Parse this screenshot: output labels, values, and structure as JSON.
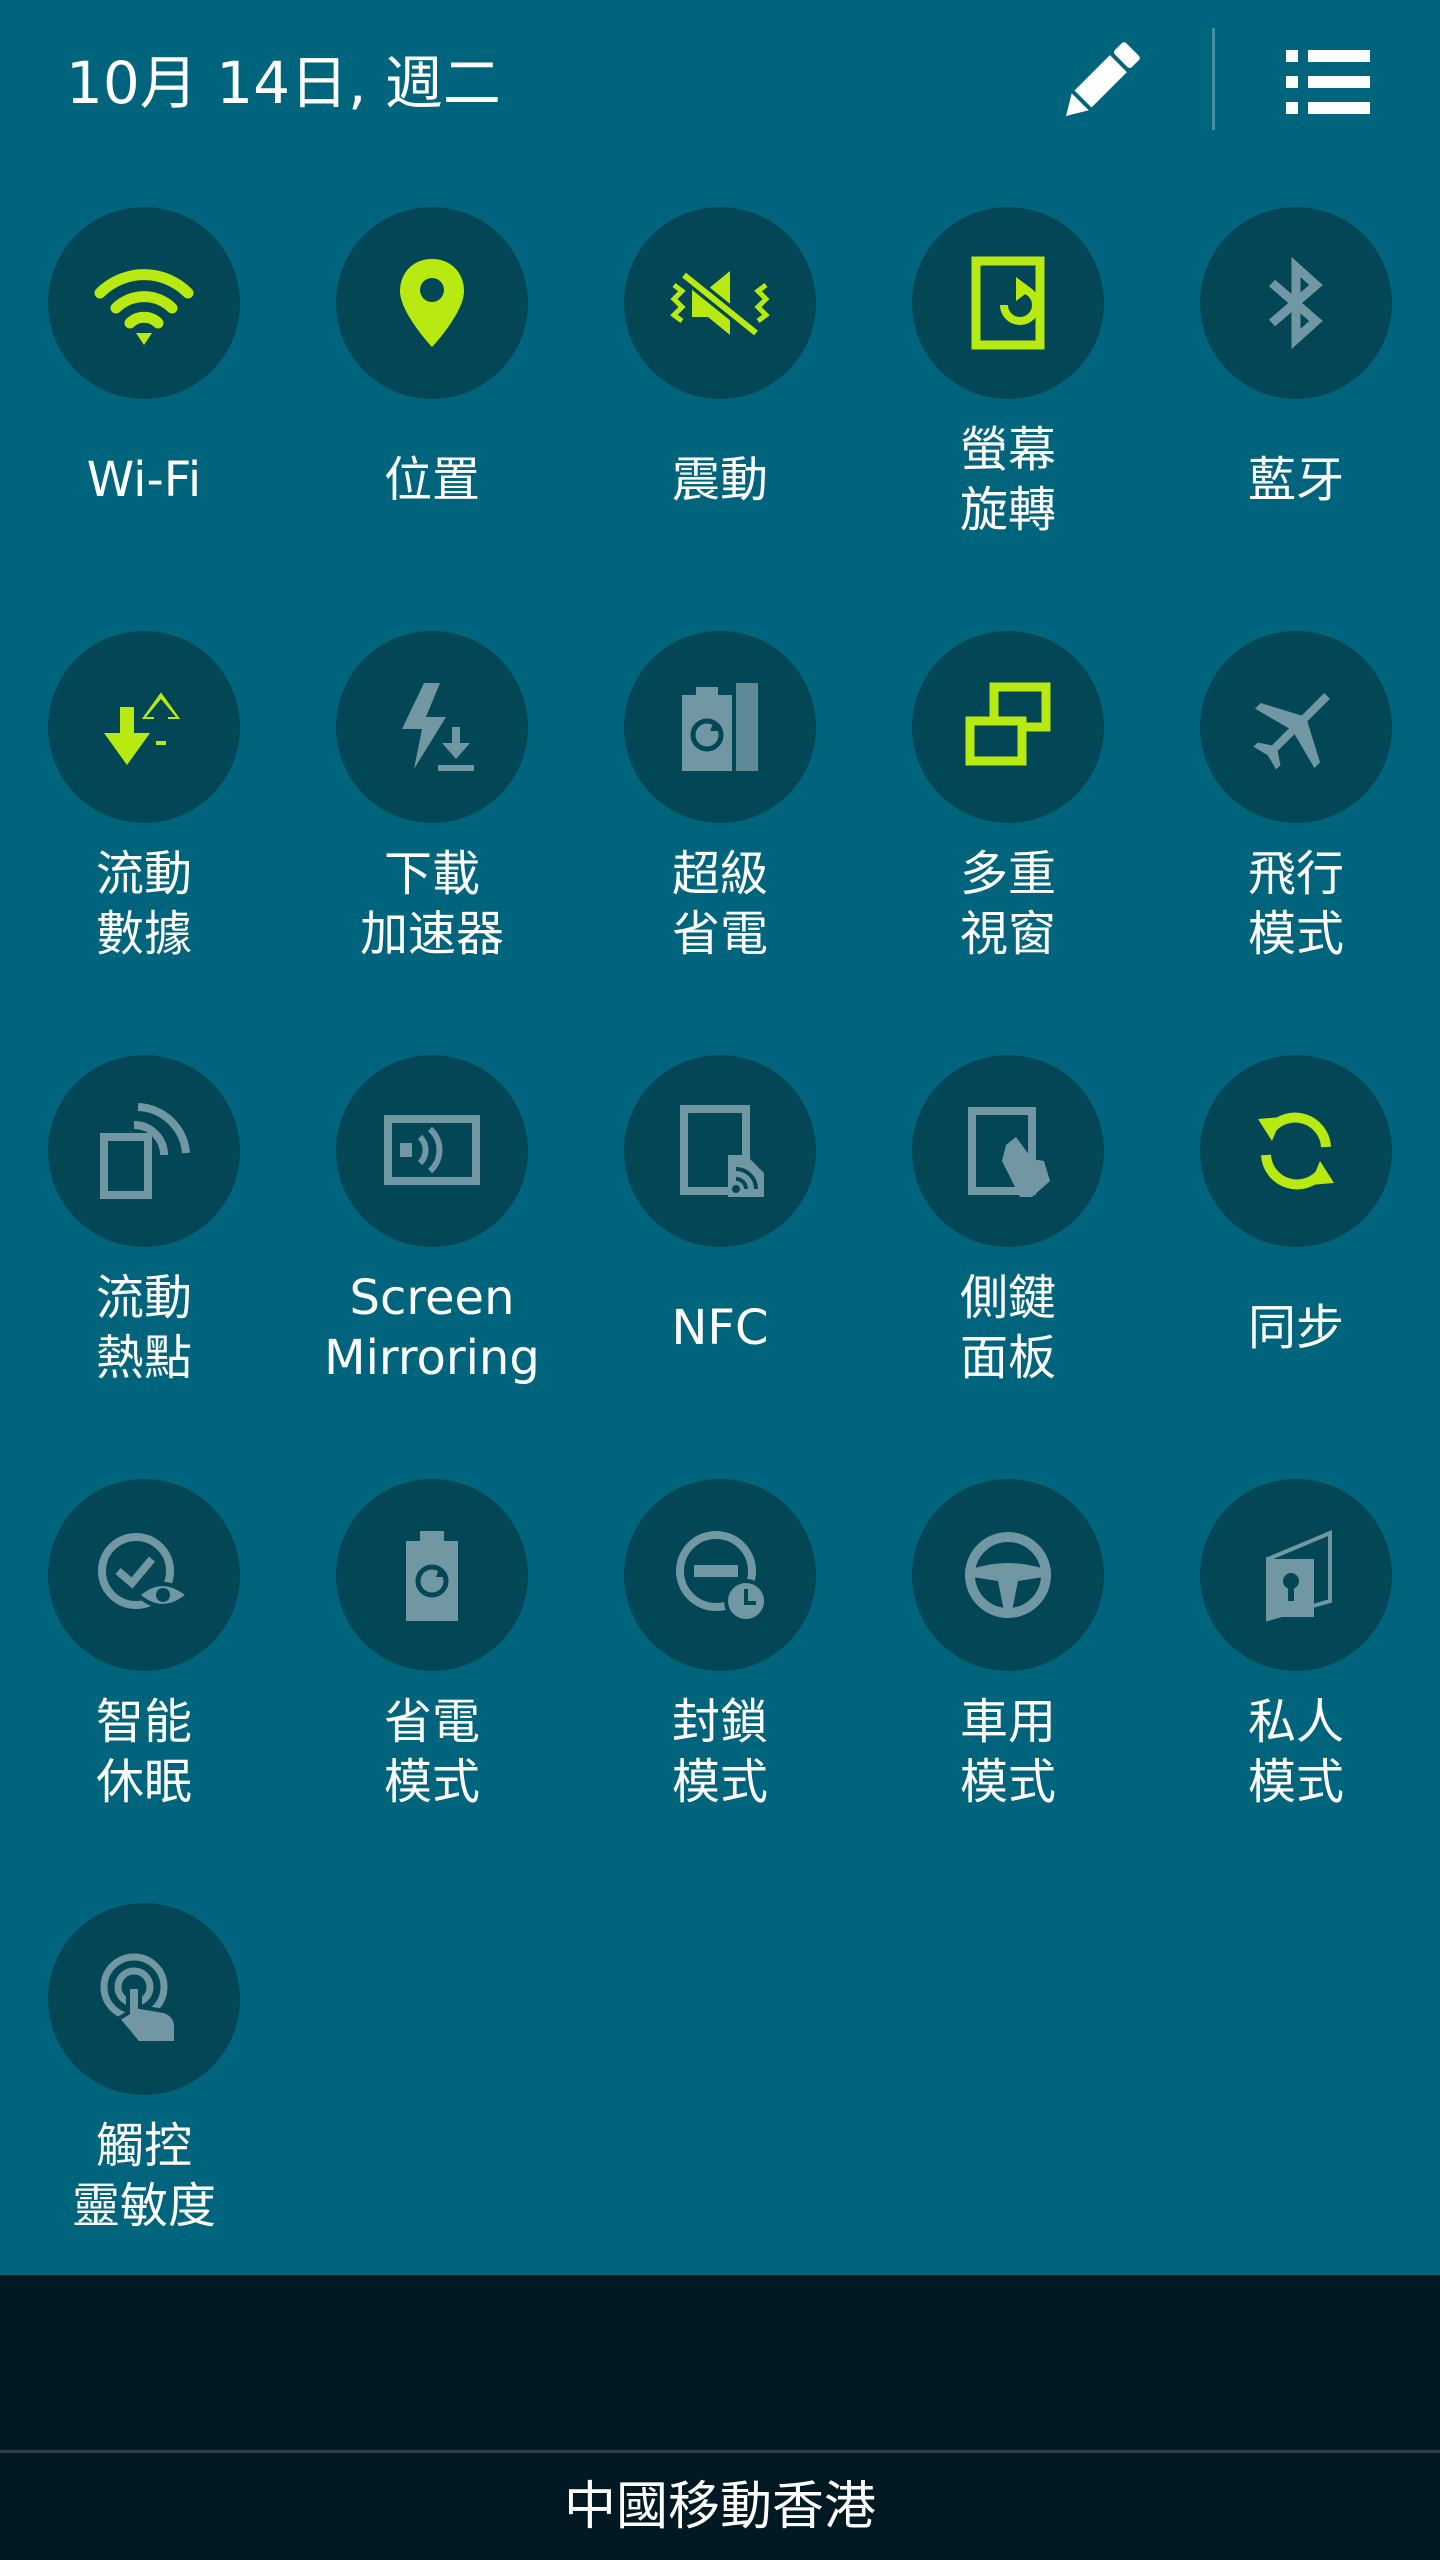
{
  "status": {
    "date": "10月 14日, 週二",
    "carrier": "中國移動香港"
  },
  "colors": {
    "panel": "#00647c",
    "circle": "#034656",
    "active": "#b8ea12",
    "inactive": "#7197a3",
    "bottom": "#021822"
  },
  "header": {
    "edit_icon": "pencil-icon",
    "menu_icon": "list-icon"
  },
  "tiles": [
    {
      "id": "wifi",
      "label": "Wi-Fi",
      "icon": "wifi-icon",
      "active": true
    },
    {
      "id": "location",
      "label": "位置",
      "icon": "location-pin-icon",
      "active": true
    },
    {
      "id": "vibrate",
      "label": "震動",
      "icon": "vibrate-icon",
      "active": true
    },
    {
      "id": "rotate",
      "label": "螢幕\n旋轉",
      "icon": "screen-rotation-icon",
      "active": true
    },
    {
      "id": "bluetooth",
      "label": "藍牙",
      "icon": "bluetooth-icon",
      "active": false
    },
    {
      "id": "mobile-data",
      "label": "流動\n數據",
      "icon": "mobile-data-icon",
      "active": true
    },
    {
      "id": "download-booster",
      "label": "下載\n加速器",
      "icon": "download-booster-icon",
      "active": false
    },
    {
      "id": "ultra-power",
      "label": "超級\n省電",
      "icon": "ultra-power-saving-icon",
      "active": false
    },
    {
      "id": "multi-window",
      "label": "多重\n視窗",
      "icon": "multi-window-icon",
      "active": true
    },
    {
      "id": "airplane",
      "label": "飛行\n模式",
      "icon": "airplane-icon",
      "active": false
    },
    {
      "id": "hotspot",
      "label": "流動\n熱點",
      "icon": "hotspot-icon",
      "active": false
    },
    {
      "id": "screen-mirroring",
      "label": "Screen\nMirroring",
      "icon": "screen-mirroring-icon",
      "active": false
    },
    {
      "id": "nfc",
      "label": "NFC",
      "icon": "nfc-icon",
      "active": false
    },
    {
      "id": "side-key-panel",
      "label": "側鍵\n面板",
      "icon": "side-key-panel-icon",
      "active": false
    },
    {
      "id": "sync",
      "label": "同步",
      "icon": "sync-icon",
      "active": true
    },
    {
      "id": "smart-stay",
      "label": "智能\n休眠",
      "icon": "smart-stay-icon",
      "active": false
    },
    {
      "id": "power-saving",
      "label": "省電\n模式",
      "icon": "power-saving-icon",
      "active": false
    },
    {
      "id": "blocking",
      "label": "封鎖\n模式",
      "icon": "blocking-mode-icon",
      "active": false
    },
    {
      "id": "car-mode",
      "label": "車用\n模式",
      "icon": "steering-wheel-icon",
      "active": false
    },
    {
      "id": "private-mode",
      "label": "私人\n模式",
      "icon": "private-mode-icon",
      "active": false
    },
    {
      "id": "touch-sensitivity",
      "label": "觸控\n靈敏度",
      "icon": "touch-sensitivity-icon",
      "active": false
    }
  ]
}
